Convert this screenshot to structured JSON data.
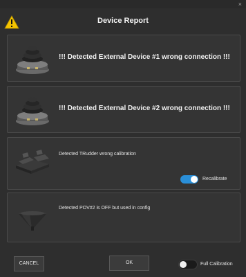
{
  "window": {
    "title": "Device Report",
    "close_glyph": "×",
    "icons": [
      "warning-triangle-icon",
      "close-icon"
    ]
  },
  "items": [
    {
      "message": "!!!  Detected External Device #1 wrong connection !!!",
      "device_icon": "joystick-knob-icon"
    },
    {
      "message": "!!!  Detected External Device #2 wrong connection !!!",
      "device_icon": "joystick-knob-icon"
    },
    {
      "message": "Detected TRudder wrong calibration",
      "device_icon": "rudder-pedals-icon",
      "toggle": {
        "label": "Recalibrate",
        "on": true
      }
    },
    {
      "message": "Detected POV#2 is OFF but used in config",
      "device_icon": "pov-hat-icon"
    }
  ],
  "footer": {
    "cancel_label": "CANCEL",
    "ok_label": "OK",
    "full_calibration": {
      "label": "Full Calibration",
      "on": false
    }
  },
  "colors": {
    "background": "#2e2e2e",
    "panel": "#343434",
    "toggle_on": "#2a8fd8",
    "toggle_off": "#1a1a1a",
    "warning": "#f5c400"
  }
}
